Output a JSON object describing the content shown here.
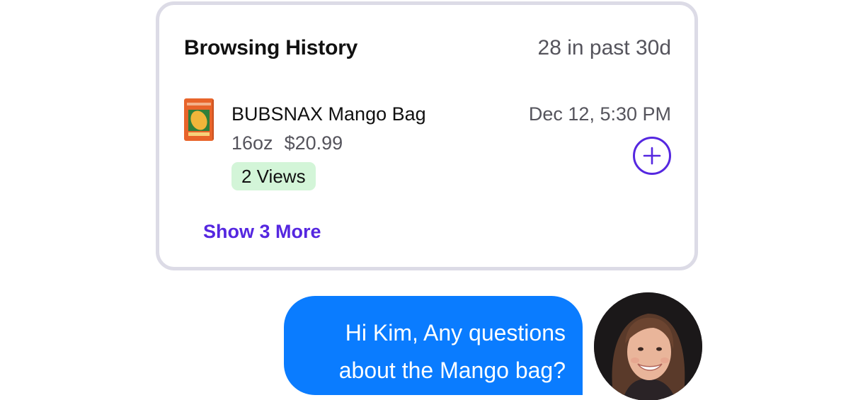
{
  "card": {
    "title": "Browsing History",
    "count": "28 in past 30d",
    "item": {
      "name": "BUBSNAX Mango Bag",
      "size": "16oz",
      "price": "$20.99",
      "views": "2 Views",
      "timestamp": "Dec 12, 5:30 PM",
      "add_icon": "plus-circle-icon"
    },
    "show_more": "Show 3 More"
  },
  "chat": {
    "message_line_1": "Hi Kim, Any questions",
    "message_line_2": "about the Mango bag?"
  },
  "colors": {
    "accent": "#5527e0",
    "bubble": "#0a7cff",
    "badge_bg": "#d3f5d8",
    "card_border": "#dcdbe6"
  }
}
